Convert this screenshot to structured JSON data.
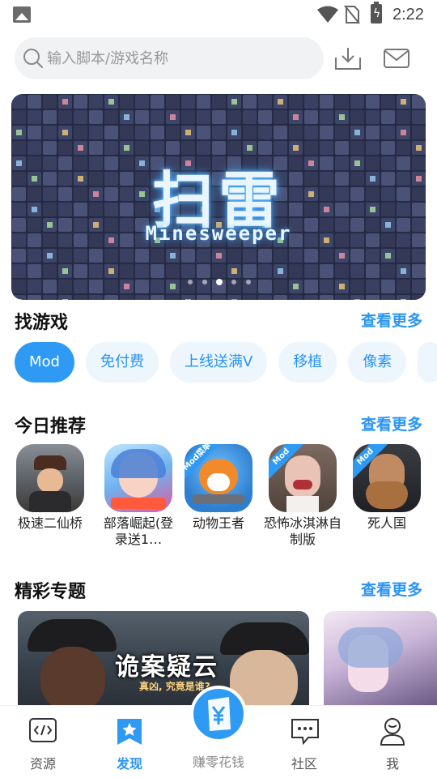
{
  "status_bar": {
    "time": "2:22",
    "battery_glyph": "ϟ"
  },
  "search": {
    "placeholder": "输入脚本/游戏名称",
    "value": ""
  },
  "banner": {
    "title": "扫雷",
    "subtitle": "Minesweeper",
    "page_count": 5,
    "active_page": 2
  },
  "find_games": {
    "title": "找游戏",
    "more": "查看更多",
    "chips": [
      "Mod",
      "免付费",
      "上线送满V",
      "移植",
      "像素"
    ],
    "active_chip": 0
  },
  "recommend": {
    "title": "今日推荐",
    "more": "查看更多",
    "apps": [
      {
        "name": "极速二仙桥",
        "mod": false
      },
      {
        "name": "部落崛起(登录送1…",
        "mod": false
      },
      {
        "name": "动物王者",
        "mod": true,
        "badge": "Mod菜单"
      },
      {
        "name": "恐怖冰淇淋自制版",
        "mod": true,
        "badge": "Mod"
      },
      {
        "name": "死人国",
        "mod": true,
        "badge": "Mod"
      }
    ]
  },
  "topics": {
    "title": "精彩专题",
    "more": "查看更多",
    "items": [
      {
        "title": "诡案疑云",
        "subtitle": "真凶, 究竟是谁?"
      }
    ]
  },
  "bottom_nav": {
    "items": [
      {
        "label": "资源",
        "icon": "code-icon"
      },
      {
        "label": "发现",
        "icon": "star-bookmark-icon"
      },
      {
        "label": "赚零花钱",
        "icon": "yen-bag-icon"
      },
      {
        "label": "社区",
        "icon": "chat-icon"
      },
      {
        "label": "我",
        "icon": "user-icon"
      }
    ],
    "active": 1
  },
  "colors": {
    "accent": "#2f9af3",
    "chip_bg": "#edf5fd",
    "search_bg": "#f1f2f4"
  }
}
